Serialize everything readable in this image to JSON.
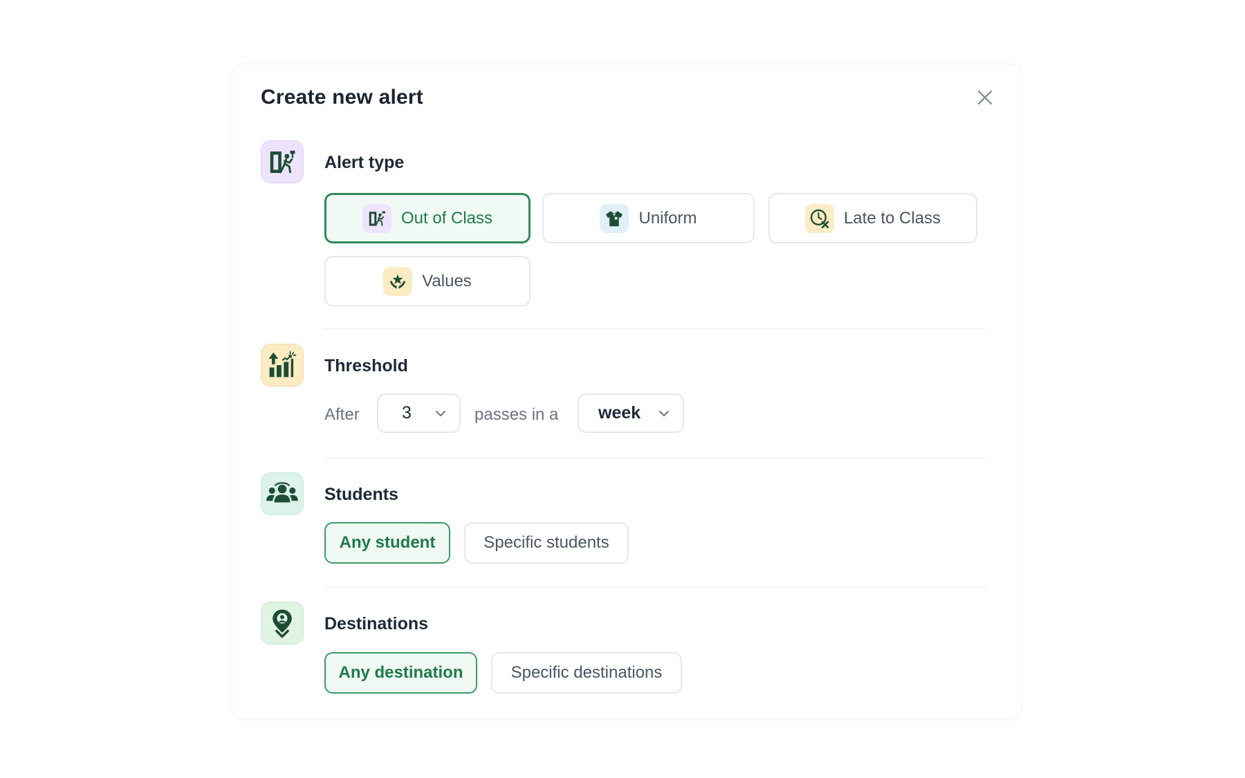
{
  "modal": {
    "title": "Create new alert"
  },
  "alert_type": {
    "title": "Alert type",
    "options": [
      {
        "label": "Out of Class",
        "icon": "exit-door-icon",
        "selected": true
      },
      {
        "label": "Uniform",
        "icon": "shirt-icon",
        "selected": false
      },
      {
        "label": "Late to Class",
        "icon": "late-clock-icon",
        "selected": false
      },
      {
        "label": "Values",
        "icon": "star-hands-icon",
        "selected": false
      }
    ]
  },
  "threshold": {
    "title": "Threshold",
    "prefix": "After",
    "count": "3",
    "middle": "passes in a",
    "period": "week"
  },
  "students": {
    "title": "Students",
    "any": "Any student",
    "specific": "Specific students"
  },
  "destinations": {
    "title": "Destinations",
    "any": "Any destination",
    "specific": "Specific destinations"
  },
  "colors": {
    "accent": "#2e8b57",
    "accent_text": "#1f7a4a",
    "icon_dark": "#1e4d36",
    "purple_tile": "#ede4fb",
    "yellow_tile": "#fbecc4",
    "mint_tile": "#dcf3ec",
    "green_tile": "#e0f4e3",
    "blue_tile": "#e1effa"
  }
}
